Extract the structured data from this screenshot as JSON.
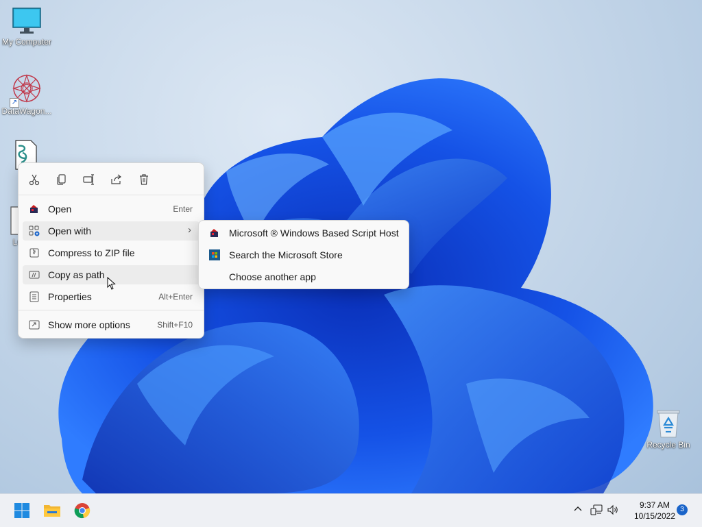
{
  "desktop": {
    "icons": [
      {
        "label": "My Computer"
      },
      {
        "label": "DataWagon..."
      },
      {
        "label": "L"
      },
      {
        "label": "LOL"
      },
      {
        "label": "Recycle Bin"
      }
    ]
  },
  "context_menu": {
    "quick_actions": [
      "cut-icon",
      "copy-icon",
      "rename-icon",
      "share-icon",
      "delete-icon"
    ],
    "items": [
      {
        "label": "Open",
        "shortcut": "Enter"
      },
      {
        "label": "Open with"
      },
      {
        "label": "Compress to ZIP file"
      },
      {
        "label": "Copy as path"
      },
      {
        "label": "Properties",
        "shortcut": "Alt+Enter"
      },
      {
        "label": "Show more options",
        "shortcut": "Shift+F10"
      }
    ],
    "submenu_arrow": "›"
  },
  "open_with_submenu": {
    "items": [
      {
        "label": "Microsoft ® Windows Based Script Host"
      },
      {
        "label": "Search the Microsoft Store"
      },
      {
        "label": "Choose another app"
      }
    ]
  },
  "taskbar": {
    "apps": [
      "start-icon",
      "file-explorer-icon",
      "chrome-icon"
    ],
    "clock": {
      "time": "9:37 AM",
      "date": "10/15/2022"
    },
    "notifications": "3"
  },
  "colors": {
    "accent": "#1a64c9",
    "menu_bg": "#f9f9f9",
    "taskbar_bg": "#eef0f4"
  }
}
